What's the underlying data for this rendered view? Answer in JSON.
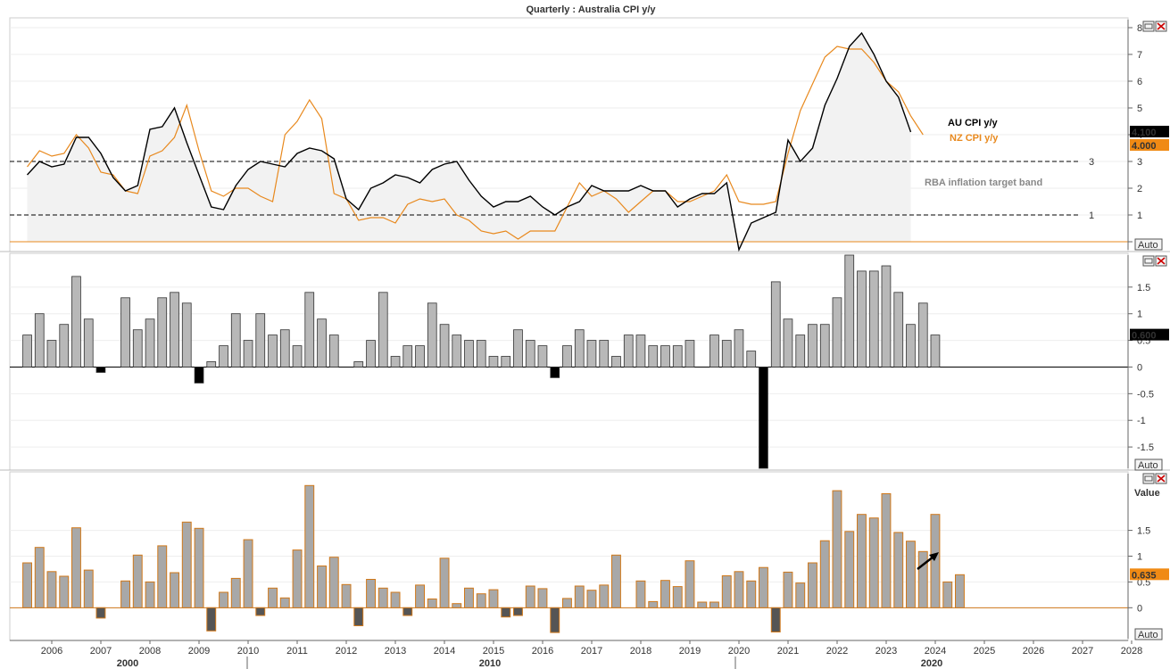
{
  "title": "Quarterly : Australia CPI y/y",
  "panel_controls": {
    "auto_label": "Auto",
    "value_label": "Value"
  },
  "colors": {
    "au": "#000000",
    "nz": "#e8891e",
    "bar_gray": "#b8b8b8",
    "bar_neg": "#000000",
    "bar3_fill": "#a8a8a8",
    "bar3_edge": "#d0781a",
    "bar3_neg": "#555555",
    "label_black_bg": "#000000",
    "label_orange_bg": "#f08a14",
    "rba_text": "#888888"
  },
  "chart_data": [
    {
      "type": "line",
      "title": "Quarterly : Australia CPI y/y",
      "x_start": 2005.5,
      "x_step": 0.25,
      "ylim": [
        -0.3,
        8.3
      ],
      "y_ticks": [
        "0",
        "1",
        "2",
        "3",
        "4",
        "5",
        "6",
        "7",
        "8"
      ],
      "series": [
        {
          "name": "AU CPI y/y",
          "color": "#000000",
          "last_label": "4.100",
          "values": [
            2.5,
            3.0,
            2.8,
            2.9,
            3.9,
            3.9,
            3.3,
            2.4,
            1.9,
            2.1,
            4.2,
            4.3,
            5.0,
            3.7,
            2.5,
            1.3,
            1.2,
            2.1,
            2.7,
            3.0,
            2.9,
            2.8,
            3.3,
            3.5,
            3.4,
            3.1,
            1.6,
            1.2,
            2.0,
            2.2,
            2.5,
            2.4,
            2.2,
            2.7,
            2.9,
            3.0,
            2.3,
            1.7,
            1.3,
            1.5,
            1.5,
            1.7,
            1.3,
            1.0,
            1.3,
            1.5,
            2.1,
            1.9,
            1.9,
            1.9,
            2.1,
            1.9,
            1.9,
            1.3,
            1.6,
            1.8,
            1.8,
            2.2,
            -0.3,
            0.7,
            0.9,
            1.1,
            3.8,
            3.0,
            3.5,
            5.1,
            6.1,
            7.3,
            7.8,
            7.0,
            6.0,
            5.4,
            4.1
          ]
        },
        {
          "name": "NZ CPI y/y",
          "color": "#e8891e",
          "last_label": "4.000",
          "values": [
            2.8,
            3.4,
            3.2,
            3.3,
            4.0,
            3.5,
            2.6,
            2.5,
            1.9,
            1.8,
            3.2,
            3.4,
            3.9,
            5.1,
            3.4,
            1.9,
            1.7,
            2.0,
            2.0,
            1.7,
            1.5,
            4.0,
            4.5,
            5.3,
            4.6,
            1.8,
            1.6,
            0.8,
            0.9,
            0.9,
            0.7,
            1.4,
            1.6,
            1.5,
            1.6,
            1.0,
            0.8,
            0.4,
            0.3,
            0.4,
            0.1,
            0.4,
            0.4,
            0.4,
            1.3,
            2.2,
            1.7,
            1.9,
            1.6,
            1.1,
            1.5,
            1.9,
            1.9,
            1.5,
            1.5,
            1.7,
            1.9,
            2.5,
            1.5,
            1.4,
            1.4,
            1.5,
            3.3,
            4.9,
            5.9,
            6.9,
            7.3,
            7.2,
            7.2,
            6.7,
            6.0,
            5.6,
            4.7,
            4.0
          ]
        }
      ],
      "reference_lines": [
        {
          "value": 3,
          "label": "3"
        },
        {
          "value": 1,
          "label": "1"
        }
      ],
      "annotation": "RBA inflation target band"
    },
    {
      "type": "bar",
      "x_start": 2005.5,
      "x_step": 0.25,
      "ylim": [
        -1.9,
        2.1
      ],
      "y_ticks": [
        "-1.5",
        "-1",
        "-0.5",
        "0",
        "0.5",
        "1",
        "1.5"
      ],
      "last_label": "0.600",
      "values": [
        0.6,
        1.0,
        0.5,
        0.8,
        1.7,
        0.9,
        -0.1,
        0.0,
        1.3,
        0.7,
        0.9,
        1.3,
        1.4,
        1.2,
        -0.3,
        0.1,
        0.4,
        1.0,
        0.5,
        1.0,
        0.6,
        0.7,
        0.4,
        1.4,
        0.9,
        0.6,
        0.0,
        0.1,
        0.5,
        1.4,
        0.2,
        0.4,
        0.4,
        1.2,
        0.8,
        0.6,
        0.5,
        0.5,
        0.2,
        0.2,
        0.7,
        0.5,
        0.4,
        -0.2,
        0.4,
        0.7,
        0.5,
        0.5,
        0.2,
        0.6,
        0.6,
        0.4,
        0.4,
        0.4,
        0.5,
        0.0,
        0.6,
        0.5,
        0.7,
        0.3,
        -1.9,
        1.6,
        0.9,
        0.6,
        0.8,
        0.8,
        1.3,
        2.1,
        1.8,
        1.8,
        1.9,
        1.4,
        0.8,
        1.2,
        0.6
      ]
    },
    {
      "type": "bar",
      "x_start": 2005.5,
      "x_step": 0.25,
      "ylim": [
        -0.6,
        2.6
      ],
      "y_ticks": [
        "0",
        "0.5",
        "1",
        "1.5"
      ],
      "last_label": "0.635",
      "values": [
        0.87,
        1.17,
        0.7,
        0.61,
        1.55,
        0.73,
        -0.2,
        0.0,
        0.52,
        1.02,
        0.5,
        1.2,
        0.68,
        1.66,
        1.54,
        -0.45,
        0.3,
        0.57,
        1.32,
        -0.15,
        0.38,
        0.19,
        1.12,
        2.37,
        0.81,
        0.98,
        0.45,
        -0.35,
        0.55,
        0.38,
        0.3,
        -0.15,
        0.44,
        0.17,
        0.96,
        0.08,
        0.38,
        0.27,
        0.35,
        -0.18,
        -0.15,
        0.42,
        0.37,
        -0.48,
        0.18,
        0.42,
        0.34,
        0.44,
        1.02,
        0.0,
        0.52,
        0.12,
        0.53,
        0.41,
        0.91,
        0.11,
        0.11,
        0.62,
        0.7,
        0.52,
        0.78,
        -0.47,
        0.69,
        0.48,
        0.87,
        1.3,
        2.27,
        1.48,
        1.81,
        1.74,
        2.21,
        1.46,
        1.29,
        1.09,
        1.81,
        0.5,
        0.64
      ]
    }
  ],
  "x_axis": {
    "years": [
      "2006",
      "2007",
      "2008",
      "2009",
      "2010",
      "2011",
      "2012",
      "2013",
      "2014",
      "2015",
      "2016",
      "2017",
      "2018",
      "2019",
      "2020",
      "2021",
      "2022",
      "2023",
      "2024",
      "2025",
      "2026",
      "2027",
      "2028"
    ],
    "decades": [
      "2000",
      "2010",
      "2020"
    ]
  }
}
